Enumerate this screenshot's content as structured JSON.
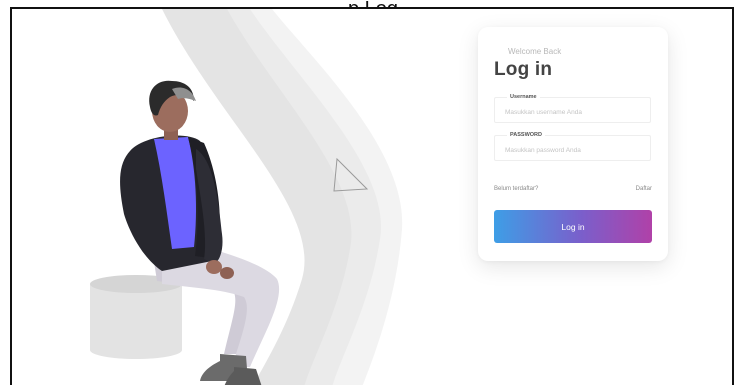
{
  "screen_title_partial": "p Log",
  "login_card": {
    "welcome_text": "Welcome Back",
    "title": "Log in",
    "username": {
      "label": "Username",
      "placeholder": "Masukkan username Anda",
      "value": ""
    },
    "password": {
      "label": "PASSWORD",
      "placeholder": "Masukkan password Anda",
      "value": ""
    },
    "signup_prompt": "Belum terdaftar?",
    "signup_link": "Daftar",
    "submit_label": "Log in"
  },
  "colors": {
    "button_gradient_start": "#3e9ee6",
    "button_gradient_mid": "#7a5fcb",
    "button_gradient_end": "#b041a8",
    "title_text": "#444444",
    "jacket": "#27272e",
    "shirt": "#6c63ff",
    "pants": "#d9d6de",
    "skin": "#9c6d5e",
    "hair": "#2b2b2b"
  },
  "illustration": {
    "subject": "person-sitting-on-stool"
  }
}
